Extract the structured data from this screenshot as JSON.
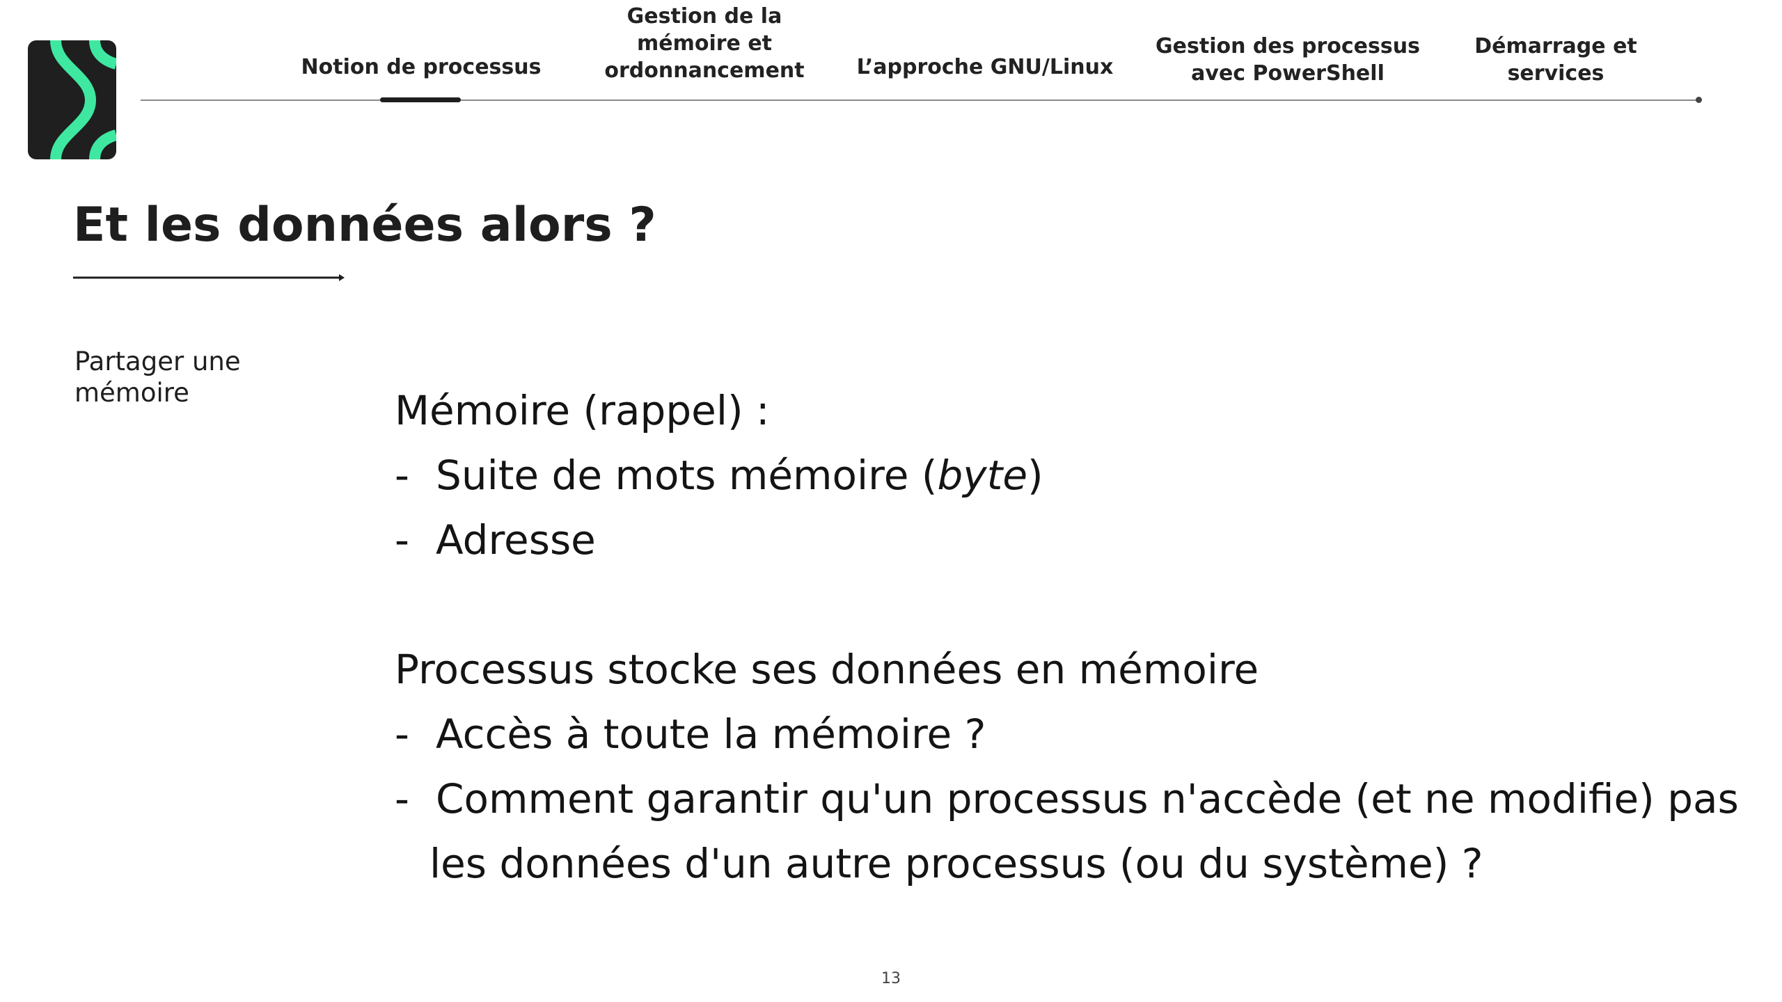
{
  "nav": {
    "items": [
      {
        "label": "Notion de processus",
        "active": true
      },
      {
        "label": "Gestion de la\nmémoire et\nordonnancement",
        "active": false
      },
      {
        "label": "L’approche GNU/Linux",
        "active": false
      },
      {
        "label": "Gestion des processus\navec PowerShell",
        "active": false
      },
      {
        "label": "Démarrage et\nservices",
        "active": false
      }
    ]
  },
  "logo": {
    "icon": "brand-chevron-logo",
    "background": "#1f1f1f",
    "accent": "#3ee8a0"
  },
  "slide": {
    "title": "Et les données alors ?",
    "sidebar_label": "Partager une mémoire",
    "content": {
      "heading1": "Mémoire (rappel) :",
      "bullet1_pre": "Suite de mots mémoire (",
      "bullet1_italic": "byte",
      "bullet1_post": ")",
      "bullet2": "Adresse",
      "heading2": "Processus stocke ses données en mémoire",
      "bullet3": "Accès à toute la mémoire ?",
      "bullet4_line1": "Comment garantir qu'un processus n'accède (et ne modifie) pas",
      "bullet4_line2": "les données d'un autre processus (ou du système) ?",
      "dash": "-"
    },
    "page_number": "13"
  },
  "colors": {
    "text": "#1e1e1e",
    "accent": "#3ee8a0",
    "rule": "#8a8a8a"
  }
}
